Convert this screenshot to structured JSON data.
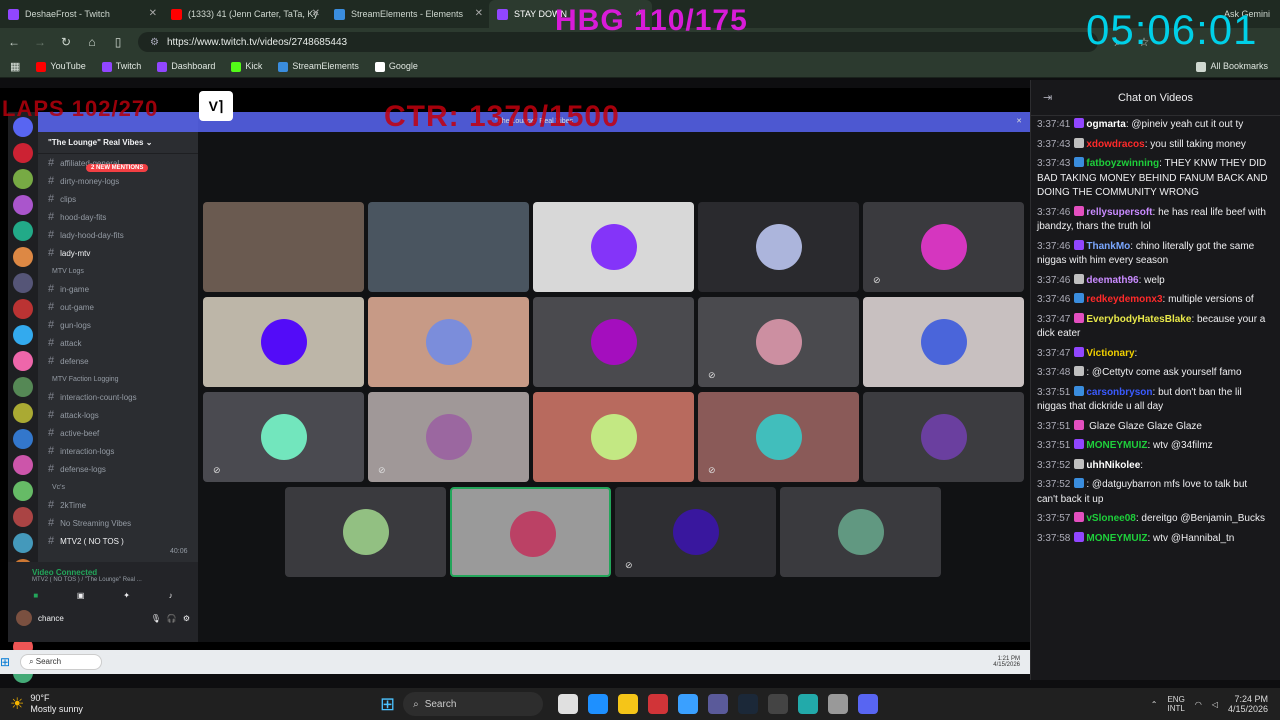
{
  "browser": {
    "tabs": [
      {
        "label": "DeshaeFrost - Twitch",
        "color": "#9146ff"
      },
      {
        "label": "(1333) 41 (Jenn Carter, TaTa, Ky",
        "color": "#ff0000"
      },
      {
        "label": "StreamElements - Elements",
        "color": "#3a8dde"
      },
      {
        "label": "STAY DOWN",
        "color": "#9146ff"
      }
    ],
    "url": "https://www.twitch.tv/videos/2748685443",
    "bookmarks": [
      {
        "label": "YouTube",
        "color": "#ff0000"
      },
      {
        "label": "Twitch",
        "color": "#9146ff"
      },
      {
        "label": "Dashboard",
        "color": "#9146ff"
      },
      {
        "label": "Kick",
        "color": "#53fc18"
      },
      {
        "label": "StreamElements",
        "color": "#3a8dde"
      },
      {
        "label": "Google",
        "color": "#ffffff"
      }
    ],
    "all_bookmarks": "All Bookmarks",
    "ask_gemini": "Ask Gemini"
  },
  "overlay": {
    "hbg": "HBG 110/175",
    "timer": "05:06:01",
    "laps": "LAPS 102/270",
    "ctr": "CTR: 1370/1500"
  },
  "discord": {
    "server_name": "\"The Lounge\" Real Vibes",
    "banner_text": "\"The Lounge\" Real Vibes",
    "mentions": "2 NEW MENTIONS",
    "channels": [
      {
        "type": "ch",
        "label": "affiliated-general"
      },
      {
        "type": "ch",
        "label": "dirty-money-logs"
      },
      {
        "type": "ch",
        "label": "clips"
      },
      {
        "type": "ch",
        "label": "hood-day-fits"
      },
      {
        "type": "ch",
        "label": "lady-hood-day-fits"
      },
      {
        "type": "ch",
        "label": "lady-mtv"
      },
      {
        "type": "cat",
        "label": "MTV Logs"
      },
      {
        "type": "ch",
        "label": "in-game"
      },
      {
        "type": "ch",
        "label": "out-game"
      },
      {
        "type": "ch",
        "label": "gun-logs"
      },
      {
        "type": "ch",
        "label": "attack"
      },
      {
        "type": "ch",
        "label": "defense"
      },
      {
        "type": "cat",
        "label": "MTV Faction Logging"
      },
      {
        "type": "ch",
        "label": "interaction-count-logs"
      },
      {
        "type": "ch",
        "label": "attack-logs"
      },
      {
        "type": "ch",
        "label": "active-beef"
      },
      {
        "type": "ch",
        "label": "interaction-logs"
      },
      {
        "type": "ch",
        "label": "defense-logs"
      },
      {
        "type": "cat",
        "label": "Vc's"
      },
      {
        "type": "ch",
        "label": "2kTime"
      },
      {
        "type": "ch",
        "label": "No Streaming Vibes"
      },
      {
        "type": "ch",
        "label": "MTV2 ( NO TOS )"
      }
    ],
    "voice_status": "Video Connected",
    "voice_sub": "MTV2 ( NO TOS ) / \"The Lounge\" Real ...",
    "voice_time": "40:06",
    "user": "chance",
    "tile_colors": [
      "#6a5a50",
      "#4a5560",
      "#d8d8d8",
      "#2a2a2e",
      "#3a3a3e",
      "#bdb6a8",
      "#c79a86",
      "#4a4a4e",
      "#4a4a4e",
      "#c8c0c0",
      "#4a4a50",
      "#a09898",
      "#b86a5e",
      "#8a5a58",
      "#3c3c40",
      "#3a3a3e",
      "#9a9a9a",
      "#2e2e32",
      "#3a3a3e"
    ]
  },
  "chat": {
    "header": "Chat on Videos",
    "messages": [
      {
        "ts": "3:37:41",
        "user": "ogmarta",
        "color": "#ffffff",
        "text": ": @pineiv yeah cut it out ty"
      },
      {
        "ts": "3:37:43",
        "user": "xdowdracos",
        "color": "#ff2a2a",
        "text": ": you still taking money"
      },
      {
        "ts": "3:37:43",
        "user": "fatboyzwinning",
        "color": "#1ecf3b",
        "text": ": THEY KNW THEY DID BAD TAKING MONEY BEHIND FANUM BACK AND DOING THE COMMUNITY WRONG"
      },
      {
        "ts": "3:37:46",
        "user": "rellysupersoft",
        "color": "#c98bff",
        "text": ": he has real life beef with jbandzy, thars the truth lol"
      },
      {
        "ts": "3:37:46",
        "user": "ThankMo",
        "color": "#7aa7ff",
        "text": ": chino literally got the same niggas with him every season"
      },
      {
        "ts": "3:37:46",
        "user": "deemath96",
        "color": "#c98bff",
        "text": ": welp"
      },
      {
        "ts": "3:37:46",
        "user": "redkeydemonx3",
        "color": "#ff2a2a",
        "text": ": multiple versions of"
      },
      {
        "ts": "3:37:47",
        "user": "EverybodyHatesBlake",
        "color": "#e8e84a",
        "text": ": because your a dick eater"
      },
      {
        "ts": "3:37:47",
        "user": "Victionary",
        "color": "#f0d000",
        "text": ":"
      },
      {
        "ts": "3:37:48",
        "user": "",
        "color": "#3a5bff",
        "text": ": @Cettytv come ask yourself famo"
      },
      {
        "ts": "3:37:51",
        "user": "carsonbryson",
        "color": "#3a5bff",
        "text": ": but don't ban the lil niggas that dickride u all day"
      },
      {
        "ts": "3:37:51",
        "user": "",
        "color": "#3a5bff",
        "text": " Glaze Glaze Glaze Glaze"
      },
      {
        "ts": "3:37:51",
        "user": "MONEYMUIZ",
        "color": "#1ecf3b",
        "text": ": wtv @34filmz"
      },
      {
        "ts": "3:37:52",
        "user": "uhhNikolee",
        "color": "#ffffff",
        "text": ":"
      },
      {
        "ts": "3:37:52",
        "user": "",
        "color": "#3a5bff",
        "text": ": @datguybarron mfs love to talk but can't back it up"
      },
      {
        "ts": "3:37:57",
        "user": "vSlonee08",
        "color": "#1ecf3b",
        "text": ": dereitgo @Benjamin_Bucks"
      },
      {
        "ts": "3:37:58",
        "user": "MONEYMUIZ",
        "color": "#1ecf3b",
        "text": ": wtv @Hannibal_tn"
      }
    ]
  },
  "inner_taskbar": {
    "search": "Search",
    "time": "1:21 PM",
    "date": "4/15/2026"
  },
  "taskbar": {
    "weather_temp": "90°F",
    "weather_desc": "Mostly sunny",
    "search": "Search",
    "lang": "ENG",
    "lang_sub": "INTL",
    "time": "7:24 PM",
    "date": "4/15/2026"
  }
}
